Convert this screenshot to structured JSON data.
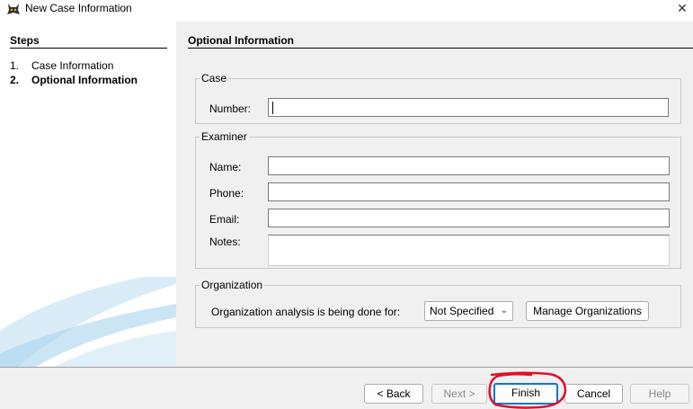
{
  "window": {
    "title": "New Case Information",
    "close_icon": "✕"
  },
  "sidebar": {
    "title": "Steps",
    "steps": [
      {
        "num": "1.",
        "label": "Case Information"
      },
      {
        "num": "2.",
        "label": "Optional Information"
      }
    ]
  },
  "main": {
    "title": "Optional Information",
    "case_group": {
      "legend": "Case",
      "number_label": "Number:",
      "number_value": ""
    },
    "examiner_group": {
      "legend": "Examiner",
      "name_label": "Name:",
      "name_value": "",
      "phone_label": "Phone:",
      "phone_value": "",
      "email_label": "Email:",
      "email_value": "",
      "notes_label": "Notes:",
      "notes_value": ""
    },
    "organization_group": {
      "legend": "Organization",
      "prompt": "Organization analysis is being done for:",
      "selected": "Not Specified",
      "manage_label": "Manage Organizations"
    }
  },
  "footer": {
    "back_label": "< Back",
    "next_label": "Next >",
    "finish_label": "Finish",
    "cancel_label": "Cancel",
    "help_label": "Help"
  },
  "colors": {
    "accent": "#0078d4",
    "annotation": "#e0102a"
  }
}
